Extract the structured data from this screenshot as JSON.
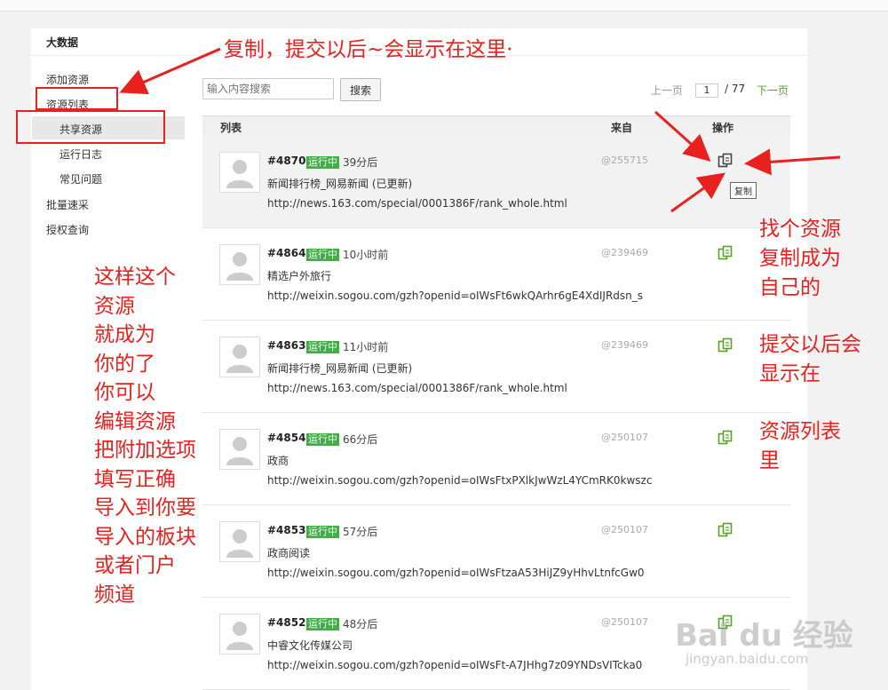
{
  "sidebar": {
    "title": "大数据",
    "items": [
      {
        "label": "添加资源"
      },
      {
        "label": "资源列表"
      },
      {
        "label": "共享资源"
      },
      {
        "label": "运行日志"
      },
      {
        "label": "常见问题"
      },
      {
        "label": "批量速采"
      },
      {
        "label": "授权查询"
      }
    ]
  },
  "search": {
    "placeholder": "输入内容搜索",
    "button": "搜索"
  },
  "pager": {
    "prev": "上一页",
    "current": "1",
    "total": "/ 77",
    "next": "下一页"
  },
  "table": {
    "headers": {
      "list": "列表",
      "from": "来自",
      "ops": "操作"
    },
    "rows": [
      {
        "id": "#4870",
        "status": "运行中",
        "time": "39分后",
        "title": "新闻排行榜_网易新闻 (已更新)",
        "url": "http://news.163.com/special/0001386F/rank_whole.html",
        "from": "@255715"
      },
      {
        "id": "#4864",
        "status": "运行中",
        "time": "10小时前",
        "title": "精选户外旅行",
        "url": "http://weixin.sogou.com/gzh?openid=oIWsFt6wkQArhr6gE4XdIJRdsn_s",
        "from": "@239469"
      },
      {
        "id": "#4863",
        "status": "运行中",
        "time": "11小时前",
        "title": "新闻排行榜_网易新闻 (已更新)",
        "url": "http://news.163.com/special/0001386F/rank_whole.html",
        "from": "@239469"
      },
      {
        "id": "#4854",
        "status": "运行中",
        "time": "66分后",
        "title": "政商",
        "url": "http://weixin.sogou.com/gzh?openid=oIWsFtxPXlkJwWzL4YCmRK0kwszc",
        "from": "@250107"
      },
      {
        "id": "#4853",
        "status": "运行中",
        "time": "57分后",
        "title": "政商阅读",
        "url": "http://weixin.sogou.com/gzh?openid=oIWsFtzaA53HiJZ9yHhvLtnfcGw0",
        "from": "@250107"
      },
      {
        "id": "#4852",
        "status": "运行中",
        "time": "48分后",
        "title": "中睿文化传媒公司",
        "url": "http://weixin.sogou.com/gzh?openid=oIWsFt-A7JHhg7z09YNDsVITcka0",
        "from": "@250107"
      }
    ]
  },
  "tooltip": "复制",
  "annotations": {
    "top": "复制，提交以后~会显示在这里·",
    "left": [
      "这样这个",
      "资源",
      "就成为",
      "你的了",
      "你可以",
      "编辑资源",
      "把附加选项",
      "填写正确",
      "导入到你要",
      "导入的板块",
      "或者门户",
      "频道"
    ],
    "right1": [
      "找个资源",
      "复制成为",
      "自己的"
    ],
    "right2": [
      "提交以后会",
      "显示在"
    ],
    "right3": [
      "资源列表",
      "里"
    ]
  },
  "watermark": {
    "logo": "Bai du 经验",
    "url": "jingyan.baidu.com"
  },
  "colors": {
    "accent_green": "#3cb043",
    "annotation_red": "#e8201e",
    "link_green": "#5a9e2e"
  }
}
